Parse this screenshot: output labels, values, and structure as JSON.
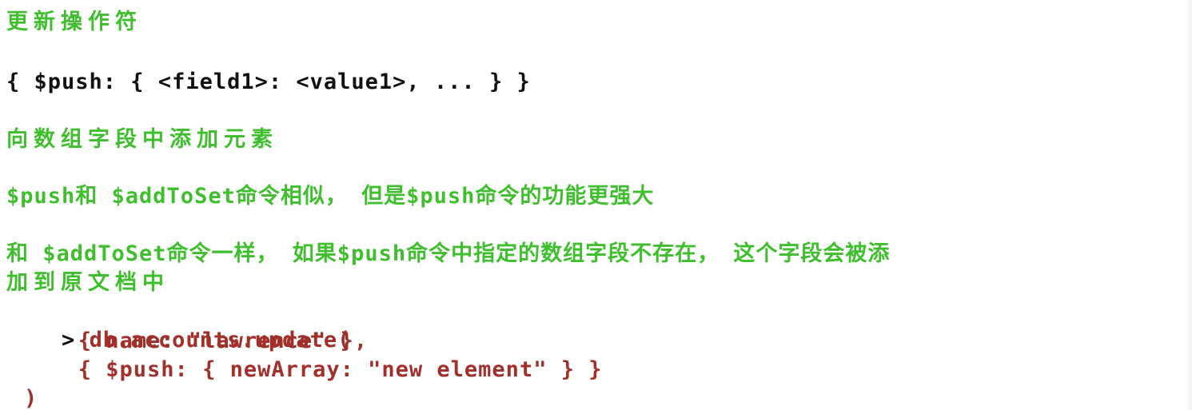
{
  "title": "更新操作符",
  "syntax": "{ $push: { <field1>: <value1>, ... } }",
  "description_1": "向数组字段中添加元素",
  "description_2": "$push和 $addToSet命令相似， 但是$push命令的功能更强大",
  "description_3_line1": "和 $addToSet命令一样， 如果$push命令中指定的数组字段不存在， 这个字段会被添",
  "description_3_line2": "加到原文档中",
  "code": {
    "prompt": ">",
    "line1": "db.accounts.update(",
    "line2": "   { name: \"lawrence\" },",
    "line3": "   { $push: { newArray: \"new element\" } }",
    "line4": ")"
  },
  "colors": {
    "heading": "#3fbf2d",
    "syntax": "#111111",
    "code": "#a1302b"
  }
}
